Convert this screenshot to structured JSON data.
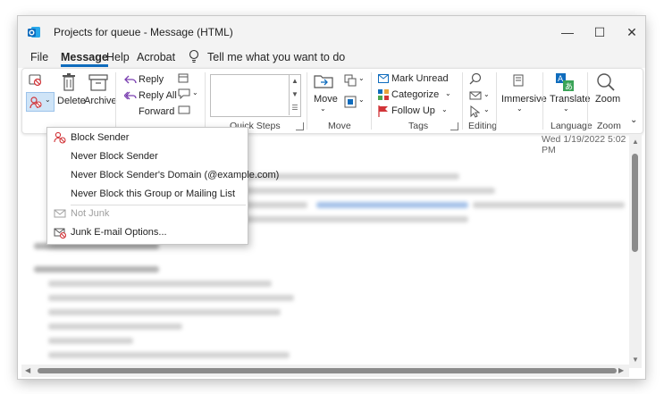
{
  "window": {
    "title": "Projects for queue  -  Message (HTML)"
  },
  "tabs": {
    "file": "File",
    "message": "Message",
    "help": "Help",
    "acrobat": "Acrobat",
    "tell_me": "Tell me what you want to do"
  },
  "ribbon": {
    "delete": "Delete",
    "archive": "Archive",
    "reply": "Reply",
    "reply_all": "Reply All",
    "forward": "Forward",
    "quick_steps": "Quick Steps",
    "move_btn": "Move",
    "move_group": "Move",
    "mark_unread": "Mark Unread",
    "categorize": "Categorize",
    "follow_up": "Follow Up",
    "tags": "Tags",
    "editing": "Editing",
    "immersive": "Immersive",
    "translate": "Translate",
    "language": "Language",
    "zoom_btn": "Zoom",
    "zoom_group": "Zoom"
  },
  "message": {
    "date": "Wed 1/19/2022 5:02 PM"
  },
  "junk_menu": {
    "block_sender": "Block Sender",
    "never_block_sender": "Never Block Sender",
    "never_block_domain": "Never Block Sender's Domain (@example.com)",
    "never_block_group": "Never Block this Group or Mailing List",
    "not_junk": "Not Junk",
    "junk_options": "Junk E-mail Options..."
  },
  "colors": {
    "accent": "#0f6cbd",
    "junk_red": "#d13438"
  }
}
